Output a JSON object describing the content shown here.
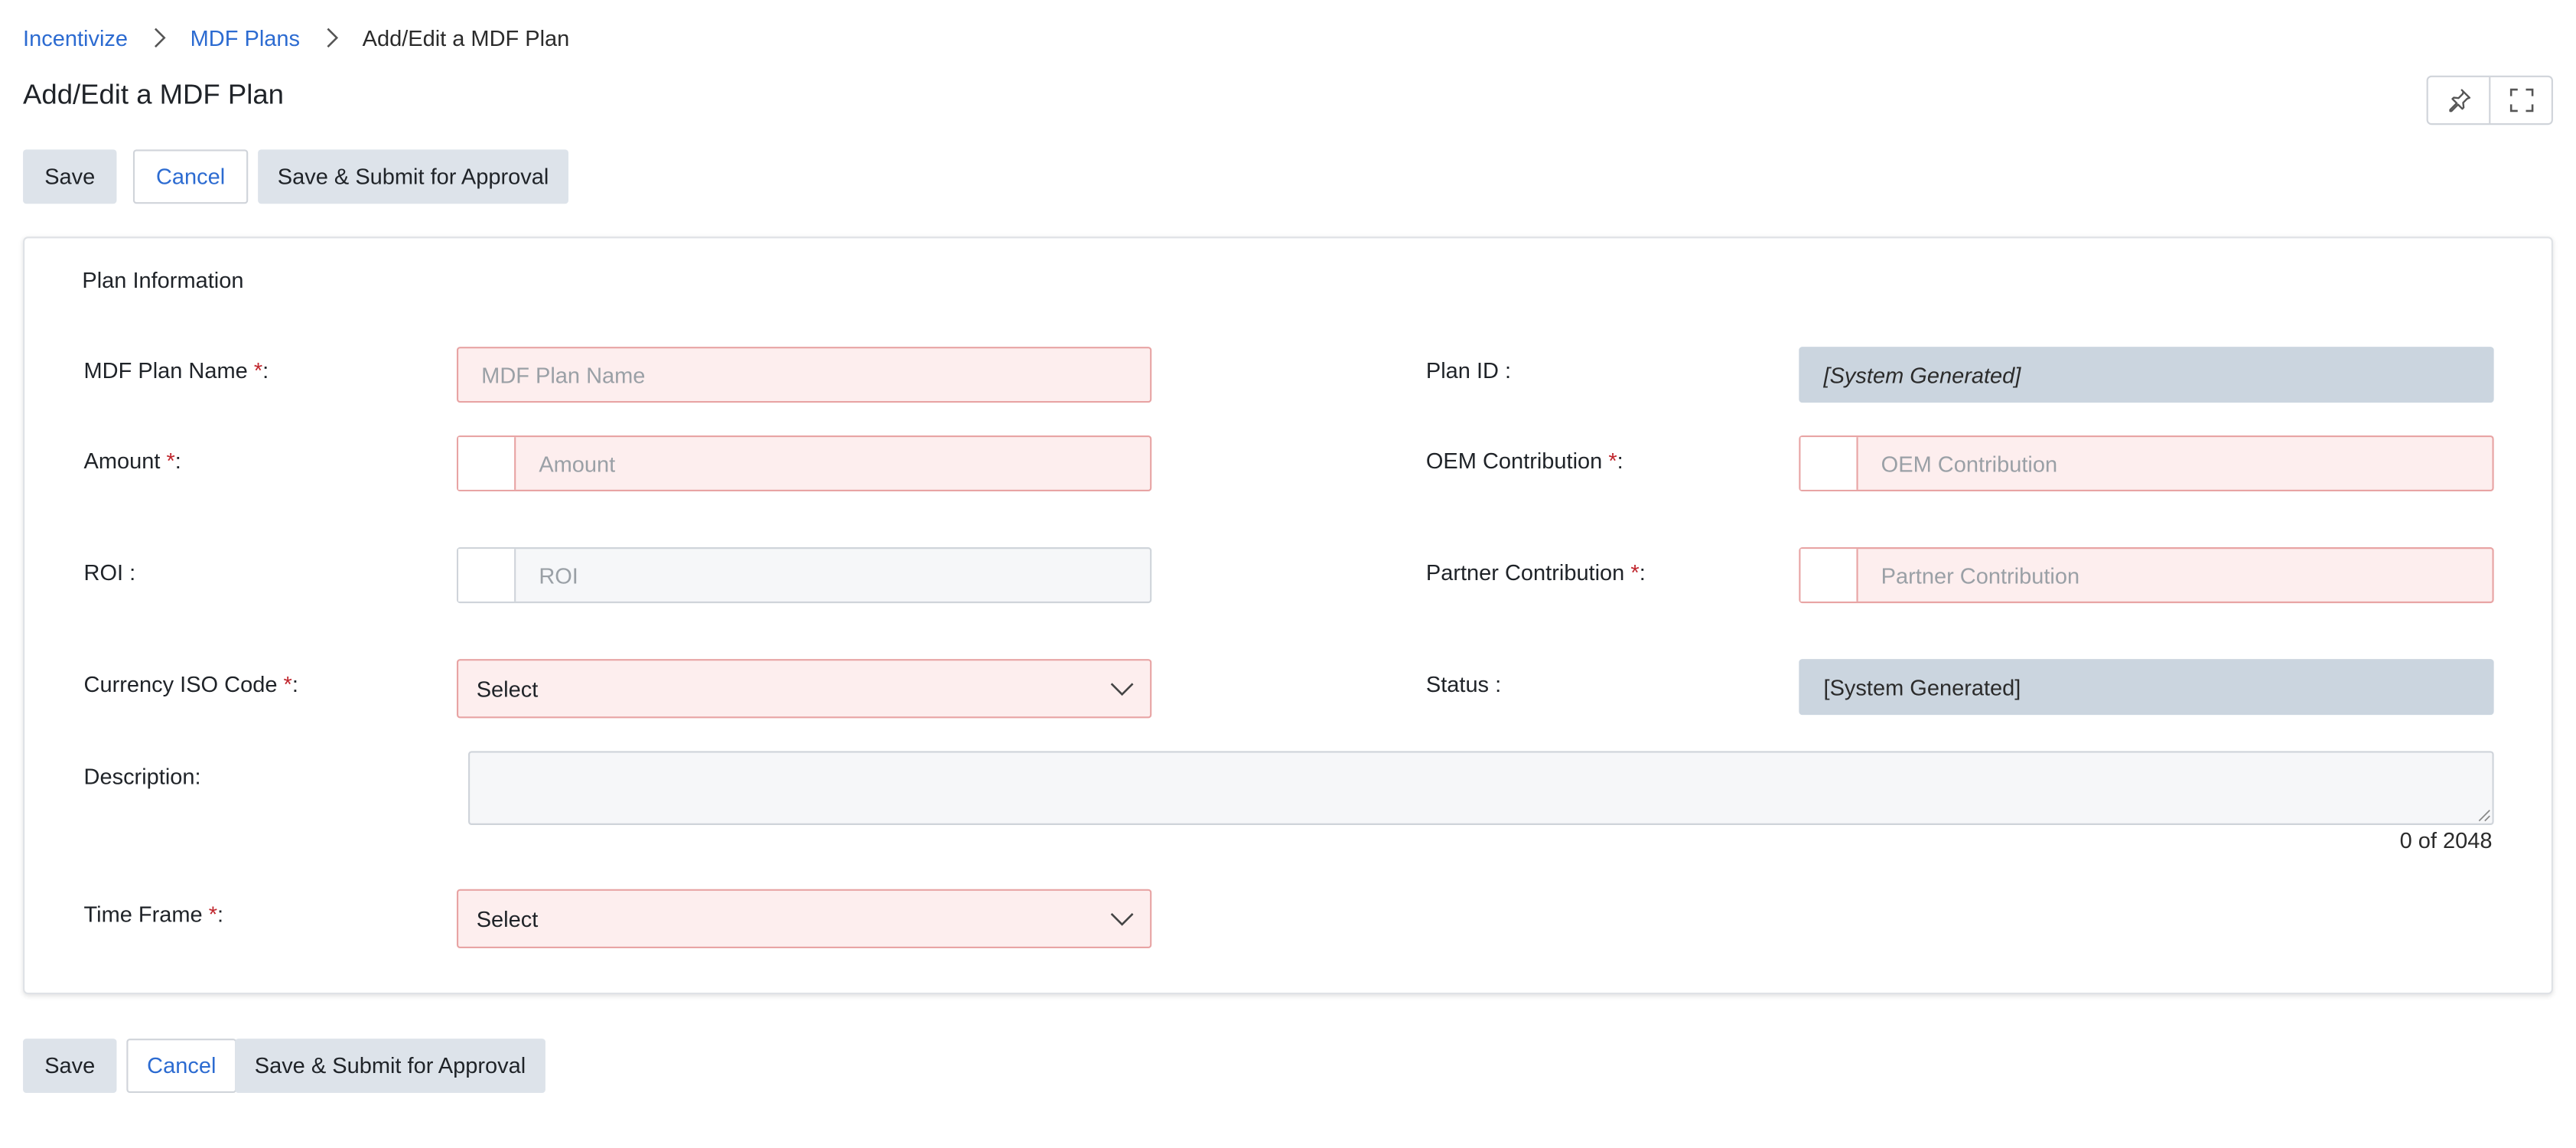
{
  "breadcrumb": {
    "items": [
      "Incentivize",
      "MDF Plans"
    ],
    "current": "Add/Edit a MDF Plan"
  },
  "page": {
    "title": "Add/Edit a MDF Plan"
  },
  "toolbar": {
    "pin_icon": "pin-icon",
    "expand_icon": "expand-icon"
  },
  "actions": {
    "save": "Save",
    "cancel": "Cancel",
    "save_submit": "Save & Submit for Approval"
  },
  "section": {
    "title": "Plan Information"
  },
  "fields": {
    "plan_name": {
      "label": "MDF Plan Name ",
      "required": "*",
      "suffix": ":",
      "placeholder": "MDF Plan Name"
    },
    "amount": {
      "label": "Amount  ",
      "required": "*",
      "suffix": ":",
      "placeholder": "Amount"
    },
    "roi": {
      "label": "ROI :",
      "placeholder": "ROI"
    },
    "currency": {
      "label": "Currency ISO Code ",
      "required": "*",
      "suffix": ":",
      "value": "Select"
    },
    "description": {
      "label": "Description:",
      "counter": "0 of 2048"
    },
    "time_frame": {
      "label": "Time Frame ",
      "required": "*",
      "suffix": ":",
      "value": "Select"
    },
    "plan_id": {
      "label": "Plan ID :",
      "value": "[System Generated]"
    },
    "oem_contribution": {
      "label": "OEM Contribution  ",
      "required": "*",
      "suffix": ":",
      "placeholder": "OEM Contribution"
    },
    "partner_contribution": {
      "label": "Partner Contribution  ",
      "required": "*",
      "suffix": ":",
      "placeholder": "Partner Contribution"
    },
    "status": {
      "label": "Status :",
      "value": "[System Generated]"
    }
  },
  "colors": {
    "link": "#2c6bd1",
    "required": "#c0262d",
    "error_fill": "#fdeeee",
    "error_border": "#e8a4a4",
    "system_fill": "#cbd5df",
    "button_gray": "#dde3ea"
  }
}
